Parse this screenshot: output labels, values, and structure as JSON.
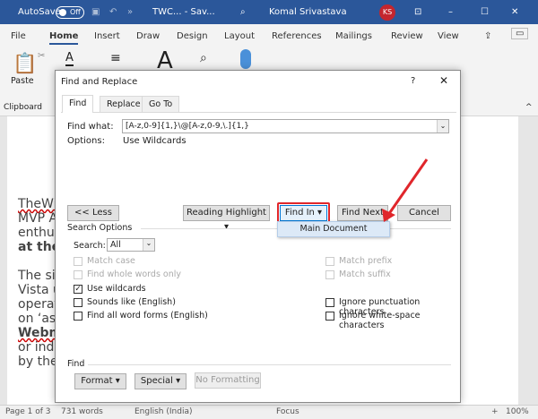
{
  "titlebar": {
    "autosave": "AutoSave",
    "toggle": "Off",
    "doc": "TWC... - Sav...",
    "user": "Komal Srivastava",
    "initials": "KS",
    "colors": {
      "bar": "#2b579a",
      "avatar": "#c4262e"
    }
  },
  "ribbon_tabs": [
    "File",
    "Home",
    "Insert",
    "Draw",
    "Design",
    "Layout",
    "References",
    "Mailings",
    "Review",
    "View"
  ],
  "ribbon": {
    "paste": "Paste",
    "clipboard": "Clipboard"
  },
  "document": {
    "lines": [
      "TheWir",
      "MVP A",
      "enthus",
      "at thev",
      "",
      "The sit",
      "Vista u",
      "operat",
      "on ‘as-",
      "Webm",
      "or indi",
      "by the"
    ]
  },
  "dialog": {
    "title": "Find and Replace",
    "help": "?",
    "tabs": [
      "Find",
      "Replace",
      "Go To"
    ],
    "find_what_label": "Find what:",
    "find_what_value": "[A-z,0-9]{1,}\\@[A-z,0-9,\\.]{1,}",
    "options_label": "Options:",
    "options_value": "Use Wildcards",
    "buttons": {
      "less": "<< Less",
      "reading_highlight": "Reading Highlight ▾",
      "find_in": "Find In ▾",
      "find_next": "Find Next",
      "cancel": "Cancel",
      "format": "Format ▾",
      "special": "Special ▾",
      "no_formatting": "No Formatting"
    },
    "dropdown_item": "Main Document",
    "search_options": "Search Options",
    "search_label": "Search:",
    "search_value": "All",
    "left_options": [
      {
        "label": "Match case",
        "checked": false,
        "disabled": true
      },
      {
        "label": "Find whole words only",
        "checked": false,
        "disabled": true
      },
      {
        "label": "Use wildcards",
        "checked": true,
        "disabled": false
      },
      {
        "label": "Sounds like (English)",
        "checked": false,
        "disabled": false
      },
      {
        "label": "Find all word forms (English)",
        "checked": false,
        "disabled": false
      }
    ],
    "right_options": [
      {
        "label": "Match prefix",
        "checked": false,
        "disabled": true
      },
      {
        "label": "Match suffix",
        "checked": false,
        "disabled": true
      },
      {
        "label": "Ignore punctuation characters",
        "checked": false,
        "disabled": false
      },
      {
        "label": "Ignore white-space characters",
        "checked": false,
        "disabled": false
      }
    ],
    "find_section": "Find",
    "highlight_color": "#e0262b"
  },
  "status": {
    "page": "Page 1 of 3",
    "words": "731 words",
    "language": "English (India)",
    "focus": "Focus",
    "zoom": "100%"
  }
}
